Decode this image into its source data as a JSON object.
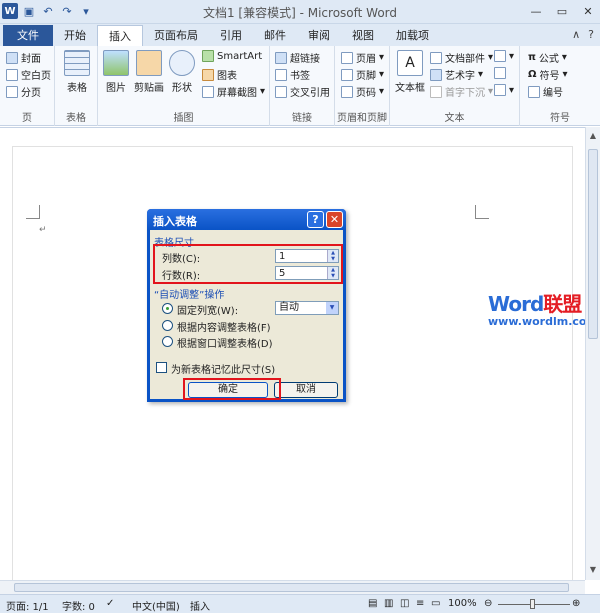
{
  "window": {
    "title": "文档1 [兼容模式] - Microsoft Word",
    "app_icon": "W",
    "quick_access": [
      "save-icon",
      "undo-icon",
      "redo-icon",
      "customize-icon"
    ]
  },
  "tabs": {
    "file": "文件",
    "items": [
      "开始",
      "插入",
      "页面布局",
      "引用",
      "邮件",
      "审阅",
      "视图",
      "加载项"
    ],
    "active": "插入"
  },
  "ribbon": {
    "pages": {
      "label": "页",
      "cover": "封面",
      "blank": "空白页",
      "break": "分页"
    },
    "tables": {
      "label": "表格",
      "table": "表格"
    },
    "illustrations": {
      "label": "插图",
      "picture": "图片",
      "clipart": "剪贴画",
      "shapes": "形状",
      "smartart": "SmartArt",
      "chart": "图表",
      "screenshot": "屏幕截图"
    },
    "links": {
      "label": "链接",
      "hyperlink": "超链接",
      "bookmark": "书签",
      "crossref": "交叉引用"
    },
    "header_footer": {
      "label": "页眉和页脚",
      "header": "页眉",
      "footer": "页脚",
      "page_number": "页码"
    },
    "text": {
      "label": "文本",
      "textbox": "文本框",
      "quickparts": "文档部件",
      "wordart": "艺术字",
      "dropcap": "首字下沉"
    },
    "symbols": {
      "label": "符号",
      "equation": "公式",
      "symbol": "符号",
      "number": "编号"
    }
  },
  "dialog": {
    "title": "插入表格",
    "help": "?",
    "close": "✕",
    "size_section": "表格尺寸",
    "columns_label": "列数(C):",
    "columns_value": "1",
    "rows_label": "行数(R):",
    "rows_value": "5",
    "autofit_section": "“自动调整”操作",
    "fixed_width_label": "固定列宽(W):",
    "fixed_width_value": "自动",
    "autofit_content_label": "根据内容调整表格(F)",
    "autofit_window_label": "根据窗口调整表格(D)",
    "remember_label": "为新表格记忆此尺寸(S)",
    "ok": "确定",
    "cancel": "取消"
  },
  "watermark": {
    "word": "Word",
    "cn": "联盟",
    "url": "www.wordlm.com"
  },
  "status": {
    "page": "页面: 1/1",
    "words": "字数: 0",
    "language": "中文(中国)",
    "mode": "插入",
    "zoom": "100%"
  },
  "colors": {
    "titlebar": "#dfe9f5",
    "file_tab": "#2b579a",
    "dialog_title": "#0a53c6",
    "highlight": "#e2141c"
  }
}
